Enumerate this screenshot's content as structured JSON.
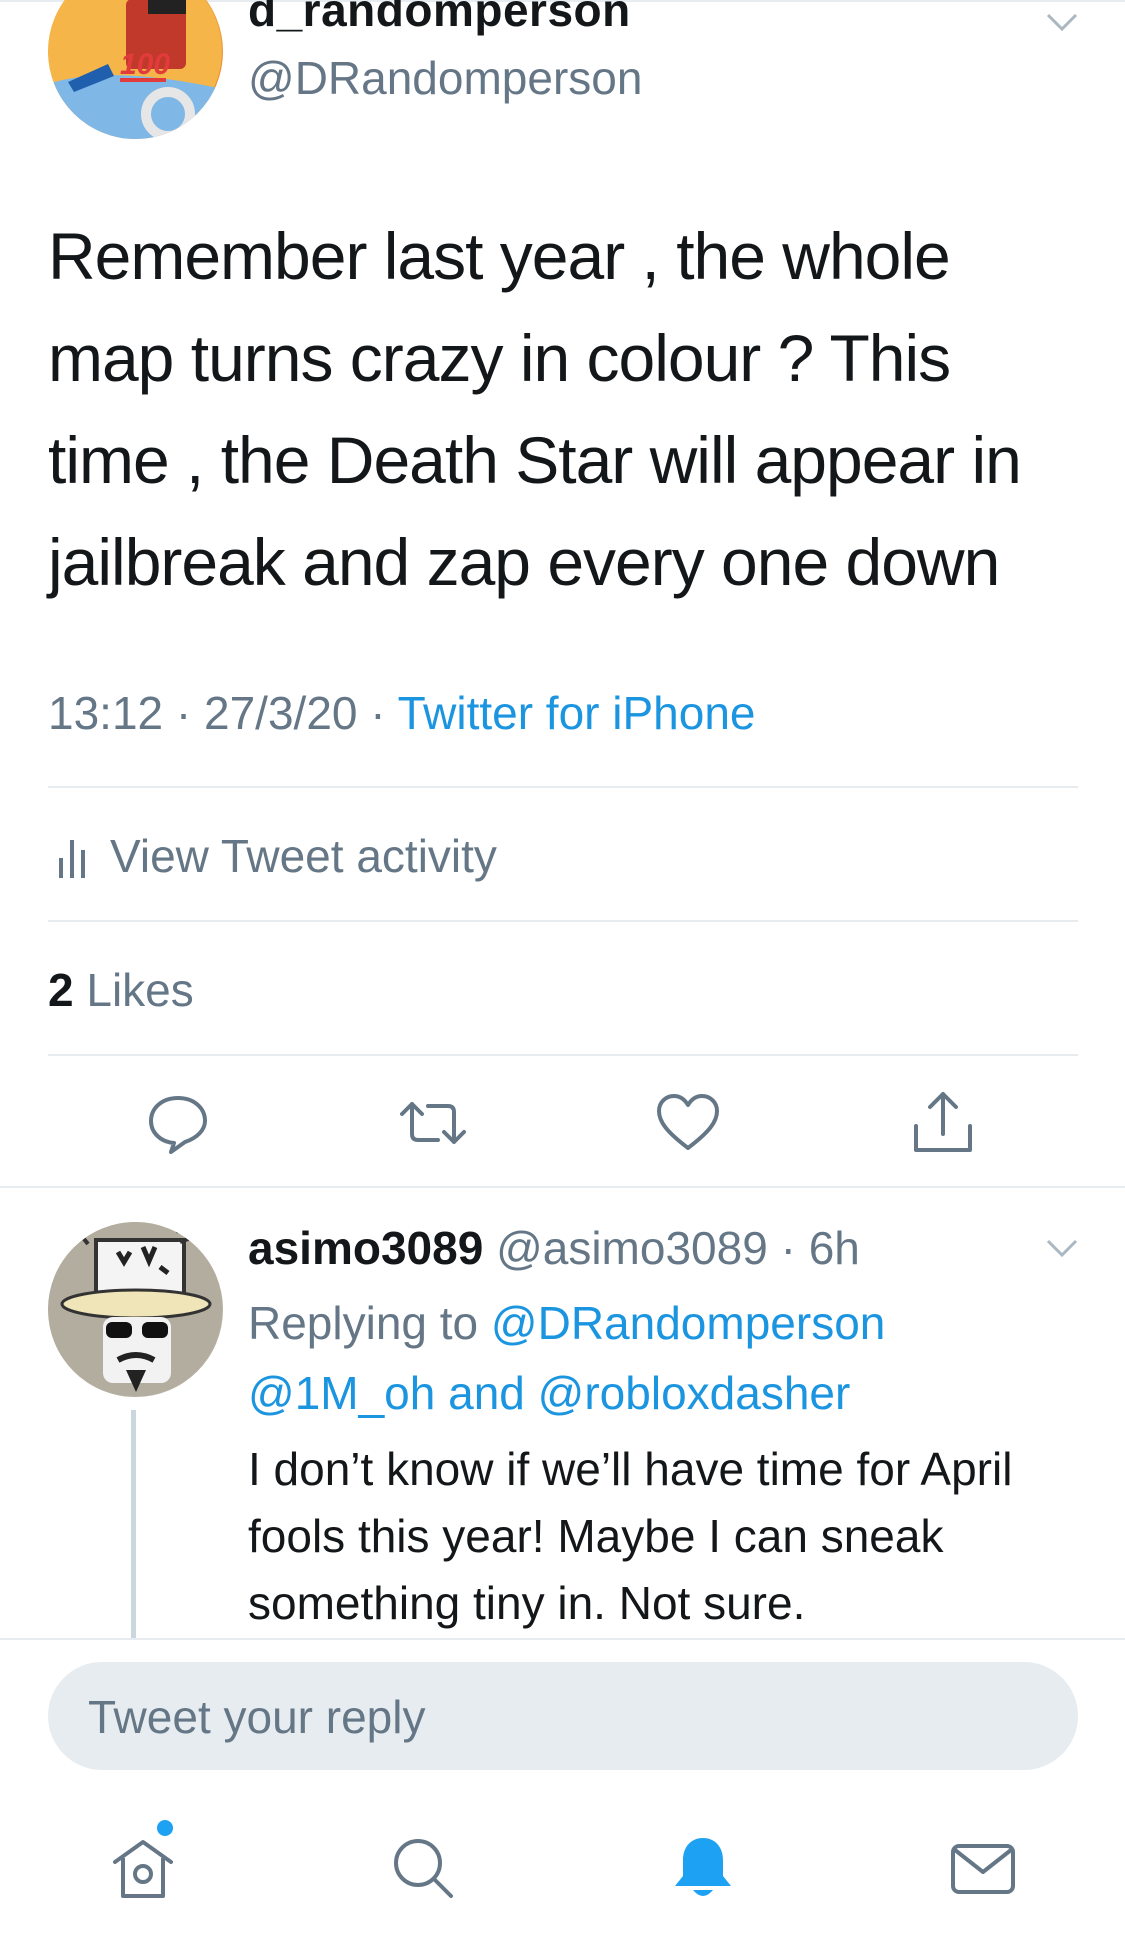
{
  "tweet": {
    "display_name": "d_randomperson",
    "handle": "@DRandomperson",
    "text": "Remember last year , the whole map turns crazy in colour ? This time , the Death Star will appear in jailbreak and zap every one down",
    "time": "13:12",
    "date": "27/3/20",
    "meta_sep": " · ",
    "source": "Twitter for iPhone",
    "activity_label": "View Tweet activity",
    "likes_count": "2",
    "likes_label": "Likes"
  },
  "reply": {
    "name": "asimo3089",
    "handle": "@asimo3089",
    "time_sep": " · ",
    "time": "6h",
    "replying_prefix": "Replying to",
    "reply_to_1": "@DRandomperson",
    "reply_to_2": "@1M_oh",
    "reply_and": "and",
    "reply_to_3": "@robloxdasher",
    "text": "I don’t know if we’ll have time for April fools this year! Maybe I can sneak something tiny in. Not sure."
  },
  "composer": {
    "placeholder": "Tweet your reply"
  },
  "icons": {
    "reply": "reply-icon",
    "retweet": "retweet-icon",
    "like": "heart-icon",
    "share": "share-icon",
    "home": "home-icon",
    "search": "search-icon",
    "notifications": "bell-icon",
    "messages": "mail-icon",
    "activity": "bar-chart-icon",
    "more": "chevron-down-icon"
  },
  "colors": {
    "accent": "#1da1f2",
    "link": "#1b95e0",
    "text": "#14171a",
    "secondary": "#657786",
    "divider": "#e6ecf0"
  }
}
